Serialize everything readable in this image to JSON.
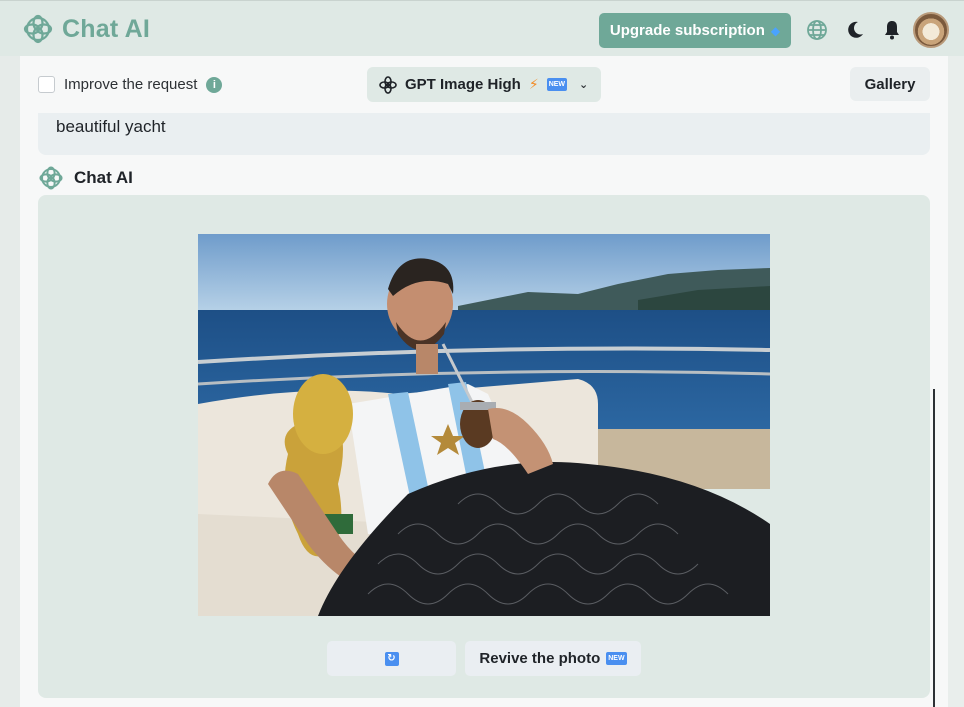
{
  "app": {
    "name": "Chat AI"
  },
  "header": {
    "upgrade_label": "Upgrade subscription",
    "icons": [
      "globe-icon",
      "moon-icon",
      "bell-icon",
      "avatar"
    ]
  },
  "toolbar": {
    "improve_label": "Improve the request",
    "improve_checked": false,
    "info_glyph": "i",
    "model_label": "GPT Image High",
    "model_badge": "NEW",
    "gallery_label": "Gallery"
  },
  "conversation": {
    "user_prompt": "beautiful yacht",
    "assistant_name": "Chat AI",
    "image_icon": "generated-image",
    "actions": {
      "regenerate_icon": "refresh-icon",
      "revive_label": "Revive the photo",
      "revive_badge": "NEW"
    }
  },
  "colors": {
    "accent": "#6fa898",
    "header_bg": "#dfe9e5",
    "card_bg": "#dfe9e5",
    "new_badge": "#4a8ff0"
  }
}
